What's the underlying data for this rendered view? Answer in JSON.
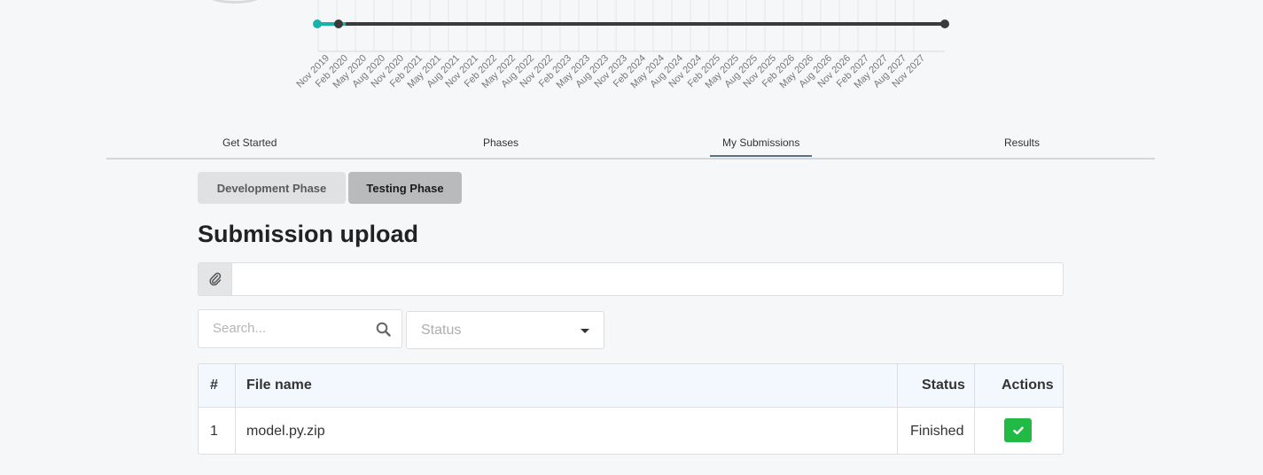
{
  "timeline": {
    "labels": [
      "Nov 2019",
      "Feb 2020",
      "May 2020",
      "Aug 2020",
      "Nov 2020",
      "Feb 2021",
      "May 2021",
      "Aug 2021",
      "Nov 2021",
      "Feb 2022",
      "May 2022",
      "Aug 2022",
      "Nov 2022",
      "Feb 2023",
      "May 2023",
      "Aug 2023",
      "Nov 2023",
      "Feb 2024",
      "May 2024",
      "Aug 2024",
      "Nov 2024",
      "Feb 2025",
      "May 2025",
      "Aug 2025",
      "Nov 2025",
      "Feb 2026",
      "May 2026",
      "Aug 2026",
      "Nov 2026",
      "Feb 2027",
      "May 2027",
      "Aug 2027",
      "Nov 2027"
    ],
    "progress_color": "#17b3a8",
    "track_color": "#3b3b3b"
  },
  "tabs": [
    {
      "label": "Get Started"
    },
    {
      "label": "Phases"
    },
    {
      "label": "My Submissions"
    },
    {
      "label": "Results"
    }
  ],
  "phases": {
    "development": "Development Phase",
    "testing": "Testing Phase"
  },
  "title": "Submission upload",
  "search": {
    "placeholder": "Search..."
  },
  "status_filter": {
    "placeholder": "Status"
  },
  "table": {
    "headers": {
      "num": "#",
      "file": "File name",
      "status": "Status",
      "actions": "Actions"
    },
    "rows": [
      {
        "num": "1",
        "file": "model.py.zip",
        "status": "Finished"
      }
    ]
  },
  "colors": {
    "action_ok": "#21ba45",
    "header_bg": "#f2f8fd"
  },
  "icons": {
    "upload": "paperclip-icon",
    "search": "search-icon",
    "dropdown": "caret-down-icon",
    "action": "check-icon"
  }
}
